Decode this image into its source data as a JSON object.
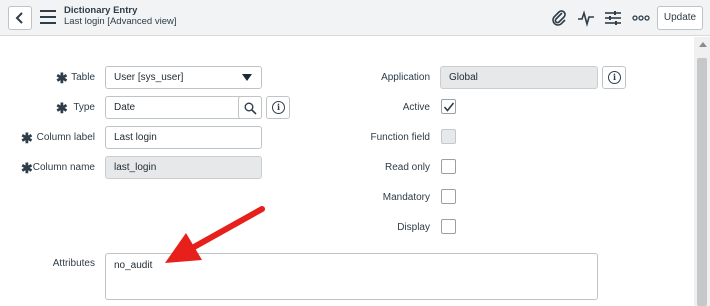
{
  "header": {
    "title": "Dictionary Entry",
    "subtitle": "Last login [Advanced view]",
    "update_label": "Update",
    "icons": [
      "back-icon",
      "menu-icon",
      "paperclip-icon",
      "activity-icon",
      "settings-sliders-icon",
      "more-options-icon"
    ]
  },
  "form": {
    "left": {
      "table": {
        "label": "Table",
        "value": "User [sys_user]"
      },
      "type": {
        "label": "Type",
        "value": "Date"
      },
      "column_label": {
        "label": "Column label",
        "value": "Last login"
      },
      "column_name": {
        "label": "Column name",
        "value": "last_login"
      }
    },
    "right": {
      "application": {
        "label": "Application",
        "value": "Global"
      },
      "active": {
        "label": "Active",
        "checked": true
      },
      "function_field": {
        "label": "Function field",
        "checked": false
      },
      "read_only": {
        "label": "Read only",
        "checked": false
      },
      "mandatory": {
        "label": "Mandatory",
        "checked": false
      },
      "display": {
        "label": "Display",
        "checked": false
      }
    },
    "attributes": {
      "label": "Attributes",
      "value": "no_audit"
    }
  },
  "annotation": {
    "type": "arrow",
    "color": "#e8201b",
    "points_to": "attributes"
  }
}
